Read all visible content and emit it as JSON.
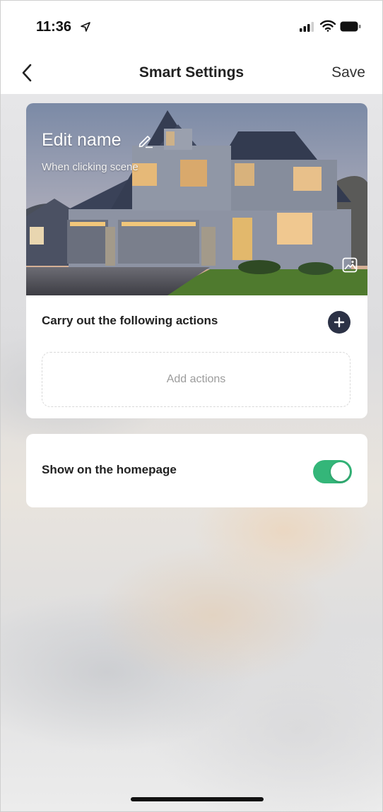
{
  "status_bar": {
    "time": "11:36"
  },
  "nav": {
    "title": "Smart Settings",
    "save_label": "Save"
  },
  "scene": {
    "name": "Edit name",
    "trigger_text": "When clicking  scene",
    "actions_label": "Carry out the following actions",
    "add_actions_label": "Add actions"
  },
  "homepage": {
    "label": "Show on the homepage",
    "enabled": true
  },
  "colors": {
    "toggle_on": "#34b679",
    "add_button": "#2c3246"
  },
  "icons": {
    "back": "chevron-left-icon",
    "edit": "pencil-icon",
    "add": "plus-icon",
    "change_image": "image-icon",
    "location": "location-arrow-icon",
    "signal": "signal-icon",
    "wifi": "wifi-icon",
    "battery": "battery-icon"
  }
}
